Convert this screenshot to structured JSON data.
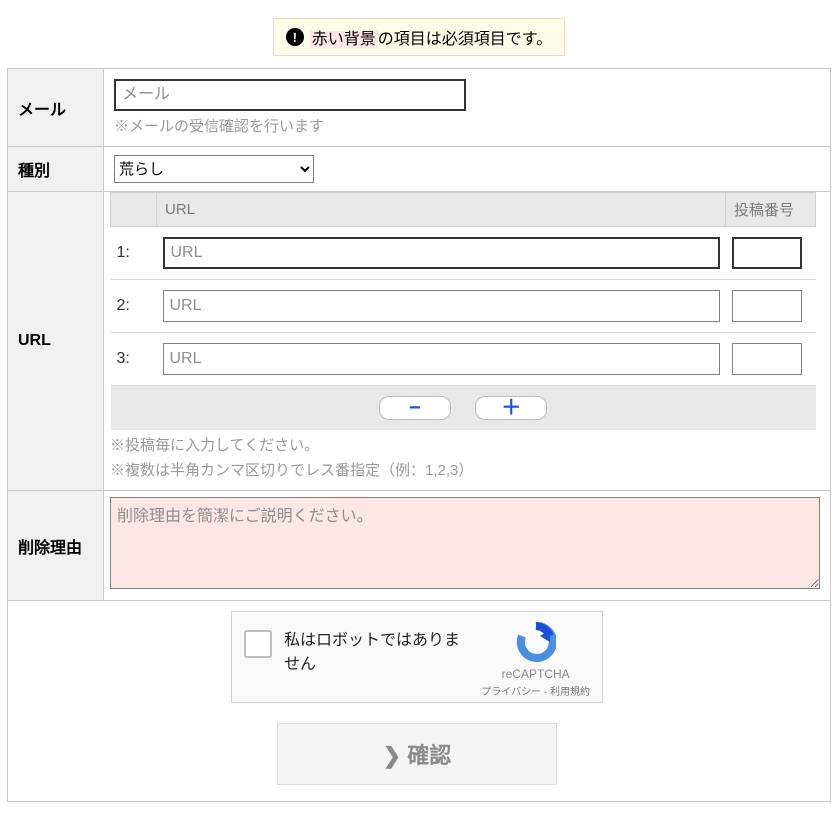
{
  "notice": {
    "prefix": "赤い背景",
    "suffix": "の項目は必須項目です。"
  },
  "fields": {
    "email": {
      "label": "メール",
      "placeholder": "メール",
      "hint": "※メールの受信確認を行います"
    },
    "type": {
      "label": "種別",
      "selected": "荒らし"
    },
    "url": {
      "label": "URL",
      "col_url": "URL",
      "col_postno": "投稿番号",
      "rows": [
        {
          "num": "1:",
          "url_placeholder": "URL",
          "required": true
        },
        {
          "num": "2:",
          "url_placeholder": "URL",
          "required": false
        },
        {
          "num": "3:",
          "url_placeholder": "URL",
          "required": false
        }
      ],
      "hint1": "※投稿毎に入力してください。",
      "hint2": "※複数は半角カンマ区切りでレス番指定（例：1,2,3）"
    },
    "reason": {
      "label": "削除理由",
      "placeholder": "削除理由を簡潔にご説明ください。"
    }
  },
  "buttons": {
    "minus": "−",
    "plus": "＋",
    "submit": "確認"
  },
  "recaptcha": {
    "label": "私はロボットではありません",
    "brand": "reCAPTCHA",
    "privacy": "プライバシー",
    "terms": "利用規約",
    "sep": " - "
  }
}
